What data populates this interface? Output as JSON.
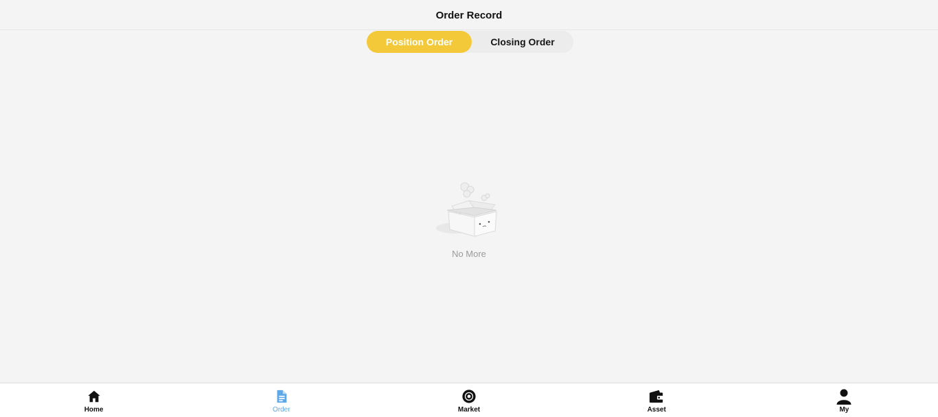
{
  "header": {
    "title": "Order Record"
  },
  "segment": {
    "tabs": [
      {
        "label": "Position Order",
        "active": true
      },
      {
        "label": "Closing Order",
        "active": false
      }
    ]
  },
  "empty_state": {
    "icon": "empty-box-illustration",
    "text": "No More"
  },
  "tabbar": {
    "active_color": "#5fa8e8",
    "items": [
      {
        "label": "Home",
        "icon": "home-icon"
      },
      {
        "label": "Order",
        "icon": "document-icon",
        "active": true
      },
      {
        "label": "Market",
        "icon": "market-icon"
      },
      {
        "label": "Asset",
        "icon": "wallet-icon"
      },
      {
        "label": "My",
        "icon": "user-icon"
      }
    ]
  },
  "colors": {
    "accent": "#f3c93a",
    "background": "#f4f4f4"
  }
}
